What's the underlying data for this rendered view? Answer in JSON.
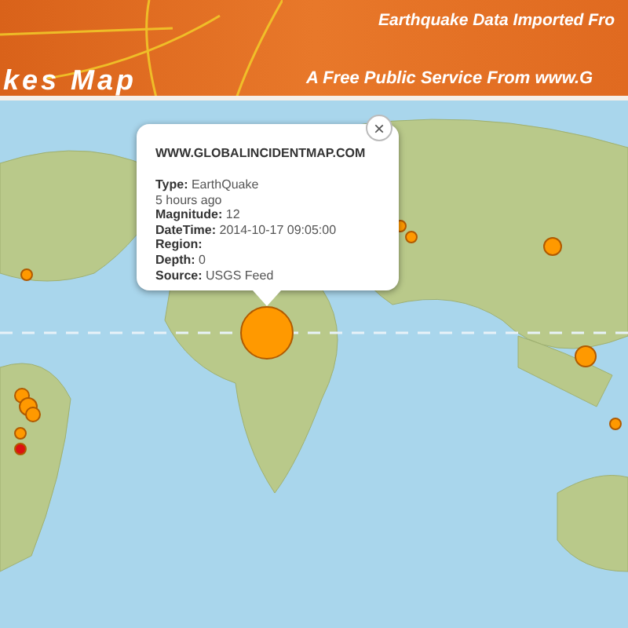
{
  "header": {
    "title": "kes Map",
    "tagline": "Earthquake Data Imported Fro",
    "service": "A Free Public Service From www.G"
  },
  "markers": [
    {
      "color": "#ff9900"
    },
    {
      "color": "#ff9900"
    },
    {
      "color": "#ff9900"
    },
    {
      "color": "#ff9900"
    },
    {
      "color": "#ff9900"
    },
    {
      "color": "#ff9900"
    },
    {
      "color": "#ff9900"
    },
    {
      "color": "#ff9900"
    },
    {
      "color": "#ff9900"
    },
    {
      "color": "#dd1111"
    },
    {
      "color": "#ff9900"
    },
    {
      "color": "#ff9900"
    }
  ],
  "popup": {
    "close": "×",
    "site": "WWW.GLOBALINCIDENTMAP.COM",
    "lines": [
      {
        "label": "Type:",
        "value": "EarthQuake"
      },
      {
        "value": "5 hours ago"
      },
      {
        "label": "Magnitude:",
        "value": "12"
      },
      {
        "label": "DateTime:",
        "value": "2014-10-17 09:05:00"
      },
      {
        "label": "Region:"
      },
      {
        "label": "Depth:",
        "value": "0"
      },
      {
        "label": "Source:",
        "value": "USGS Feed"
      }
    ]
  }
}
